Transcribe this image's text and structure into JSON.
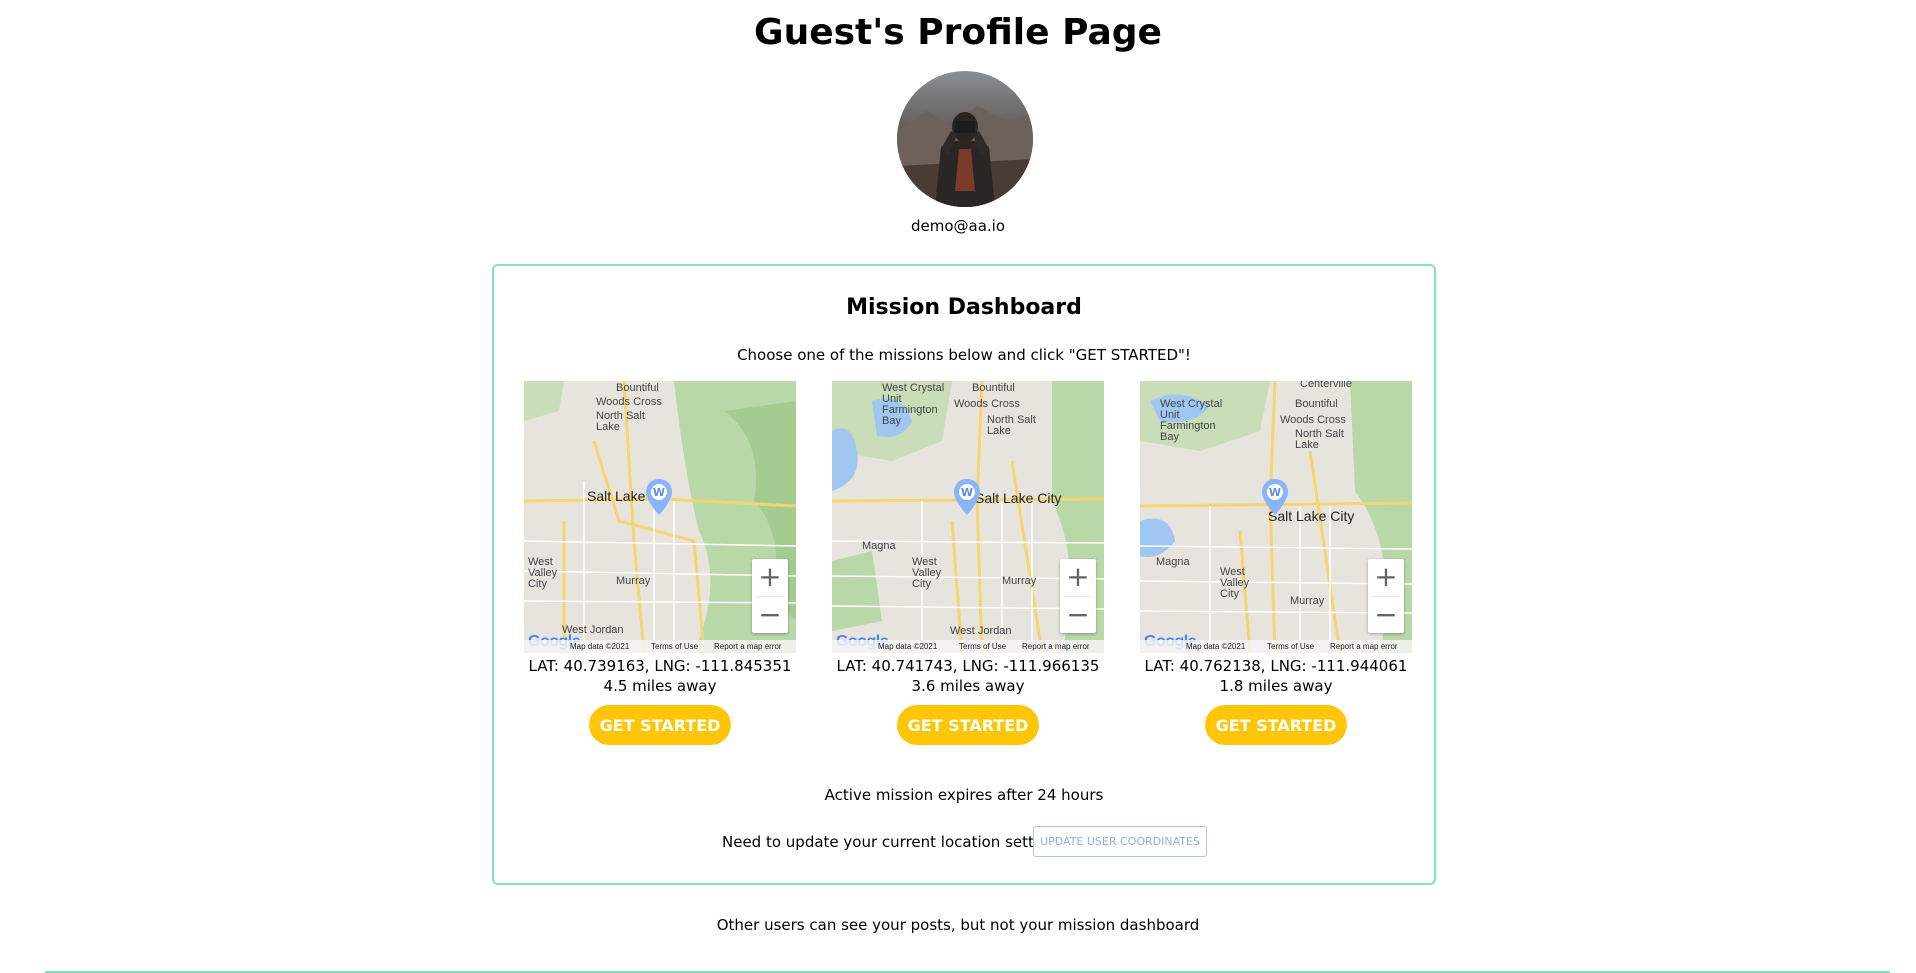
{
  "page": {
    "title": "Guest's Profile Page"
  },
  "profile": {
    "email": "demo@aa.io",
    "avatar_icon": "person-with-camera-photo"
  },
  "dashboard": {
    "title": "Mission Dashboard",
    "subtitle": "Choose one of the missions below and click \"GET STARTED\"!",
    "missions": [
      {
        "coords": "LAT: 40.739163, LNG: -111.845351",
        "distance": "4.5 miles away",
        "button_label": "GET STARTED",
        "map_labels": [
          "Bountiful",
          "Woods Cross",
          "North Salt Lake",
          "Salt Lake",
          "West Valley City",
          "Murray",
          "West Jordan"
        ]
      },
      {
        "coords": "LAT: 40.741743, LNG: -111.966135",
        "distance": "3.6 miles away",
        "button_label": "GET STARTED",
        "map_labels": [
          "West Crystal Unit Farmington Bay",
          "Bountiful",
          "Woods Cross",
          "North Salt Lake",
          "Salt Lake City",
          "Magna",
          "West Valley City",
          "Murray",
          "West Jordan"
        ]
      },
      {
        "coords": "LAT: 40.762138, LNG: -111.944061",
        "distance": "1.8 miles away",
        "button_label": "GET STARTED",
        "map_labels": [
          "Centerville",
          "West Crystal Unit Farmington Bay",
          "Bountiful",
          "Woods Cross",
          "North Salt Lake",
          "Salt Lake City",
          "Magna",
          "West Valley City",
          "Murray"
        ]
      }
    ],
    "map_footer": {
      "logo": "Google",
      "data": "Map data ©2021",
      "terms": "Terms of Use",
      "report": "Report a map error",
      "zoom_in": "+",
      "zoom_out": "−"
    },
    "expires_note": "Active mission expires after 24 hours",
    "update_prompt": "Need to update your current location settings?",
    "update_button": "UPDATE USER COORDINATES"
  },
  "footer": {
    "note": "Other users can see your posts, but not your mission dashboard"
  },
  "colors": {
    "accent_border": "#7fe3c4",
    "button_yellow": "#ffc607",
    "update_button_blue": "#8fb0ec"
  }
}
